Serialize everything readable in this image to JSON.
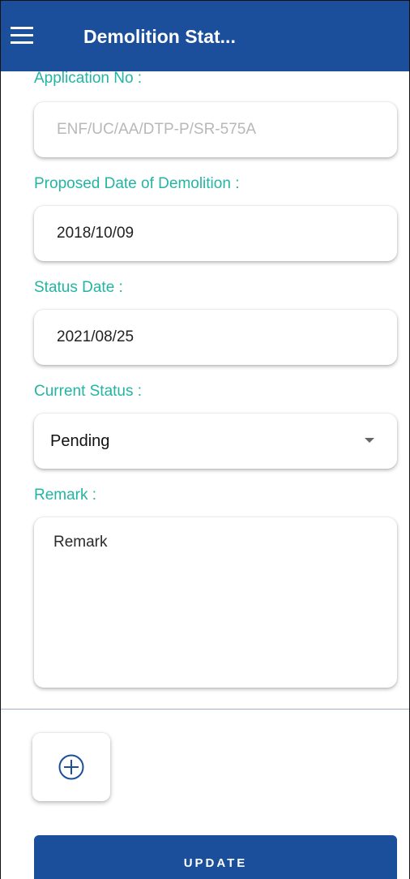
{
  "header": {
    "title": "Demolition Stat..."
  },
  "form": {
    "application_no": {
      "label": "Application No :",
      "value": "",
      "placeholder": "ENF/UC/AA/DTP-P/SR-575A"
    },
    "proposed_date": {
      "label": "Proposed Date of Demolition :",
      "value": "2018/10/09"
    },
    "status_date": {
      "label": "Status Date :",
      "value": "2021/08/25"
    },
    "current_status": {
      "label": "Current Status :",
      "selected": "Pending"
    },
    "remark": {
      "label": "Remark :",
      "value": "",
      "placeholder": "Remark"
    }
  },
  "actions": {
    "update_label": "UPDATE",
    "add_icon": "plus-circle-icon"
  },
  "colors": {
    "primary": "#1b4f9c",
    "label": "#23b5a4"
  }
}
